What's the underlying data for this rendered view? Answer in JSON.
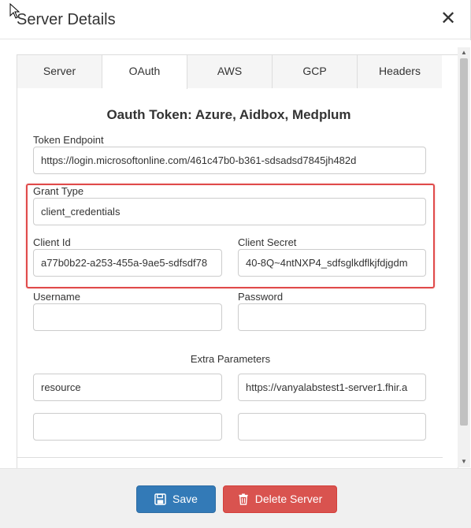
{
  "dialog": {
    "title": "Server Details",
    "close_glyph": "✕"
  },
  "tabs": [
    {
      "label": "Server",
      "active": false
    },
    {
      "label": "OAuth",
      "active": true
    },
    {
      "label": "AWS",
      "active": false
    },
    {
      "label": "GCP",
      "active": false
    },
    {
      "label": "Headers",
      "active": false
    }
  ],
  "form": {
    "title": "Oauth Token: Azure, Aidbox, Medplum",
    "token_endpoint": {
      "label": "Token Endpoint",
      "value": "https://login.microsoftonline.com/461c47b0-b361-sdsadsd7845jh482d"
    },
    "grant_type": {
      "label": "Grant Type",
      "value": "client_credentials"
    },
    "client_id": {
      "label": "Client Id",
      "value": "a77b0b22-a253-455a-9ae5-sdfsdf78"
    },
    "client_secret": {
      "label": "Client Secret",
      "value": "40-8Q~4ntNXP4_sdfsglkdflkjfdjgdm"
    },
    "username": {
      "label": "Username",
      "value": ""
    },
    "password": {
      "label": "Password",
      "value": ""
    },
    "extra_parameters": {
      "label": "Extra Parameters",
      "rows": [
        {
          "key": "resource",
          "value": "https://vanyalabstest1-server1.fhir.a"
        },
        {
          "key": "",
          "value": ""
        }
      ]
    }
  },
  "footer": {
    "save_label": "Save",
    "delete_label": "Delete Server"
  },
  "colors": {
    "primary": "#337ab7",
    "danger": "#d9534f",
    "highlight": "#e04a4a"
  },
  "icons": [
    "cursor-arrow-icon",
    "close-icon",
    "save-icon",
    "trash-icon",
    "scroll-up-icon",
    "scroll-down-icon"
  ]
}
